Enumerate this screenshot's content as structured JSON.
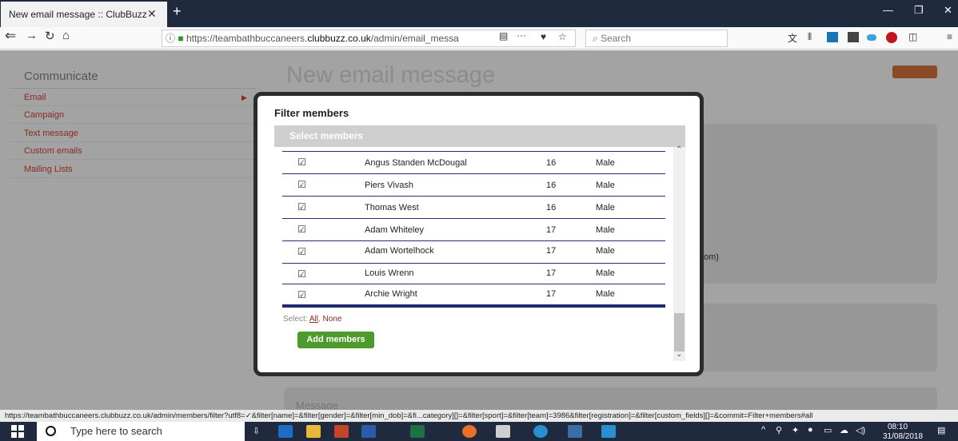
{
  "browser": {
    "tab_title": "New email message :: ClubBuzz",
    "tab_close": "✕",
    "new_tab": "+",
    "url_prefix": "https://teambathbuccaneers.",
    "url_domain": "clubbuzz.co.uk",
    "url_path": "/admin/email_messa",
    "search_placeholder": "Search",
    "menu_dots": "···",
    "window_min": "—",
    "window_max": "❐",
    "window_close": "✕"
  },
  "sidebar": {
    "title": "Communicate",
    "items": [
      {
        "label": "Email"
      },
      {
        "label": "Campaign"
      },
      {
        "label": "Text message"
      },
      {
        "label": "Custom emails"
      },
      {
        "label": "Mailing Lists"
      }
    ]
  },
  "main": {
    "page_title": "New email message",
    "bg_fragment": "om)",
    "message_label": "Message"
  },
  "modal": {
    "title": "Filter members",
    "section_header": "Select members",
    "members": [
      {
        "name": "Angus Standen McDougal",
        "age": "16",
        "gender": "Male"
      },
      {
        "name": "Piers Vivash",
        "age": "16",
        "gender": "Male"
      },
      {
        "name": "Thomas West",
        "age": "16",
        "gender": "Male"
      },
      {
        "name": "Adam Whiteley",
        "age": "17",
        "gender": "Male"
      },
      {
        "name": "Adam Wortelhock",
        "age": "17",
        "gender": "Male"
      },
      {
        "name": "Louis Wrenn",
        "age": "17",
        "gender": "Male"
      },
      {
        "name": "Archie Wright",
        "age": "17",
        "gender": "Male"
      }
    ],
    "checkbox_glyph": "☑",
    "select_label": "Select:",
    "select_all": "All",
    "select_none": "None",
    "add_button": "Add members"
  },
  "status_url": "https://teambathbuccaneers.clubbuzz.co.uk/admin/members/filter?utf8=✓&filter[name]=&filter[gender]=&filter[min_dob]=&fi...category][]=&filter[sport]=&filter[team]=3986&filter[registration]=&filter[custom_fields][]=&commit=Filter+members#all",
  "taskbar": {
    "search_text": "Type here to search",
    "time": "08:10",
    "date": "31/08/2018"
  },
  "colors": {
    "accent_red": "#8a2a20",
    "list_border": "#2b2f7a",
    "add_green": "#4f9a2c"
  }
}
